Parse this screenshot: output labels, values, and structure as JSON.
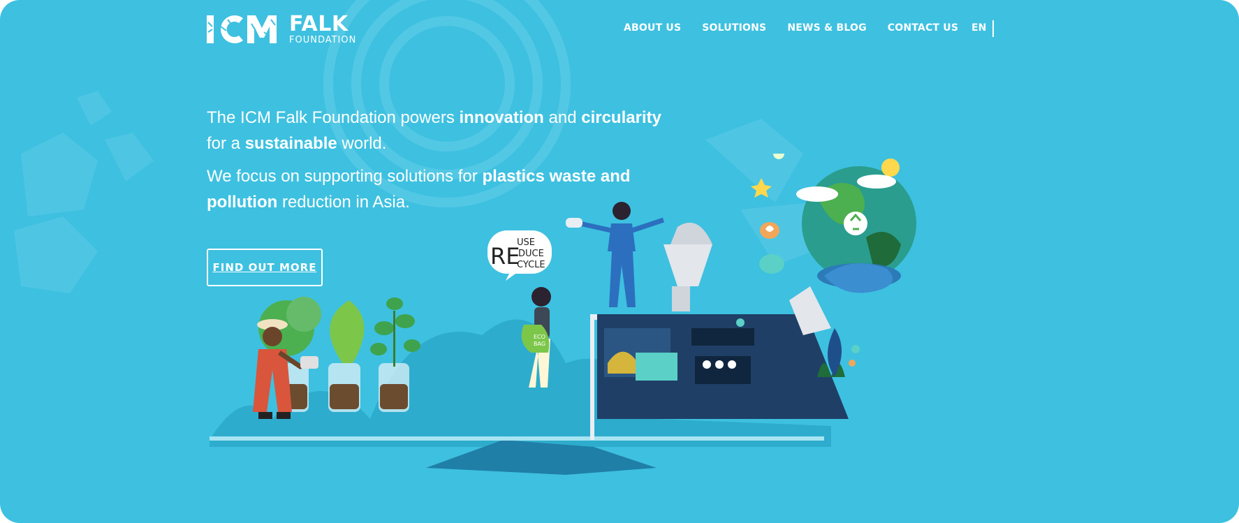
{
  "header": {
    "logo": {
      "mark": "ICM",
      "name": "FALK",
      "subtitle": "FOUNDATION"
    },
    "nav": [
      {
        "label": "ABOUT US"
      },
      {
        "label": "SOLUTIONS"
      },
      {
        "label": "NEWS & BLOG"
      },
      {
        "label": "CONTACT US"
      }
    ],
    "language": "EN"
  },
  "hero": {
    "line1": {
      "t1": "The ICM Falk Foundation powers ",
      "b1": "innovation",
      "t2": " and ",
      "b2": "circularity",
      "t3": " for a ",
      "b3": "sustainable",
      "t4": " world."
    },
    "line2": {
      "t1": "We focus on supporting solutions for ",
      "b1": "plastics waste and pollution",
      "t2": " reduction in Asia."
    },
    "cta_label": "FIND OUT MORE"
  },
  "illustration": {
    "speech_bubble": {
      "prefix": "RE",
      "lines": [
        "USE",
        "DUCE",
        "CYCLE"
      ]
    },
    "bag_label": {
      "line1": "ECO",
      "line2": "BAG"
    }
  },
  "colors": {
    "background": "#3ec1e0",
    "text": "#ffffff",
    "machine": "#1f3f66",
    "plant": "#4caf50"
  }
}
